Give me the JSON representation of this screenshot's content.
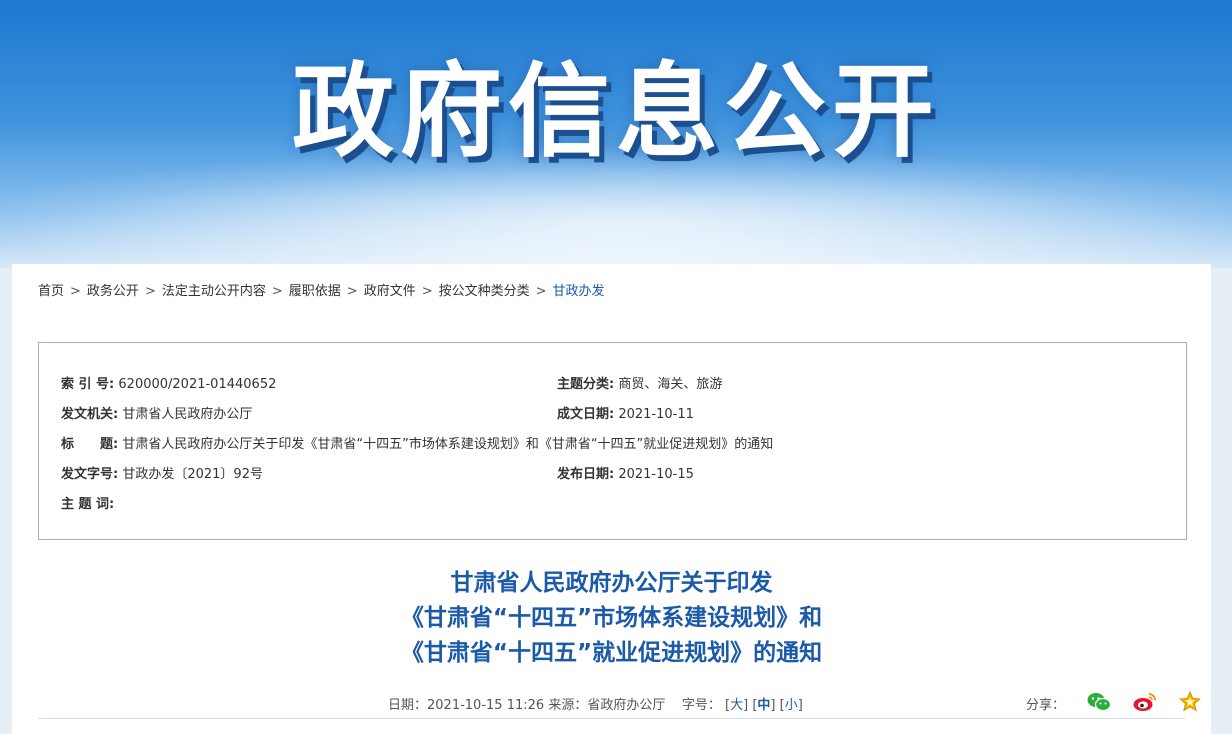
{
  "banner": {
    "title": "政府信息公开"
  },
  "breadcrumb": [
    {
      "label": "首页"
    },
    {
      "label": "政务公开"
    },
    {
      "label": "法定主动公开内容"
    },
    {
      "label": "履职依据"
    },
    {
      "label": "政府文件"
    },
    {
      "label": "按公文种类分类"
    },
    {
      "label": "甘政办发"
    }
  ],
  "breadcrumb_separator": ">",
  "info": {
    "index_key": "索 引 号:",
    "index_value": "620000/2021-01440652",
    "topic_key": "主题分类:",
    "topic_value": "商贸、海关、旅游",
    "issuer_key": "发文机关:",
    "issuer_value": "甘肃省人民政府办公厅",
    "created_key": "成文日期:",
    "created_value": "2021-10-11",
    "title_key": "标　　题:",
    "title_value": "甘肃省人民政府办公厅关于印发《甘肃省“十四五”市场体系建设规划》和《甘肃省“十四五”就业促进规划》的通知",
    "docno_key": "发文字号:",
    "docno_value": "甘政办发〔2021〕92号",
    "published_key": "发布日期:",
    "published_value": "2021-10-15",
    "keywords_key": "主 题 词:",
    "keywords_value": ""
  },
  "document": {
    "title_line1": "甘肃省人民政府办公厅关于印发",
    "title_line2": "《甘肃省“十四五”市场体系建设规划》和",
    "title_line3": "《甘肃省“十四五”就业促进规划》的通知"
  },
  "meta": {
    "date_label": "日期：",
    "date_value": "2021-10-15 11:26",
    "source_label": "来源：",
    "source_value": "省政府办公厅",
    "fontsize_label": "字号：",
    "size_large": "大",
    "size_medium": "中",
    "size_small": "小"
  },
  "share": {
    "label": "分享：",
    "icons": [
      "wechat-icon",
      "weibo-icon",
      "favorite-star-icon"
    ]
  },
  "colors": {
    "accent": "#1a5aa8",
    "banner_top": "#1e78cf",
    "wechat": "#2aae3b",
    "weibo": "#e6162d",
    "star": "#f2b600"
  }
}
